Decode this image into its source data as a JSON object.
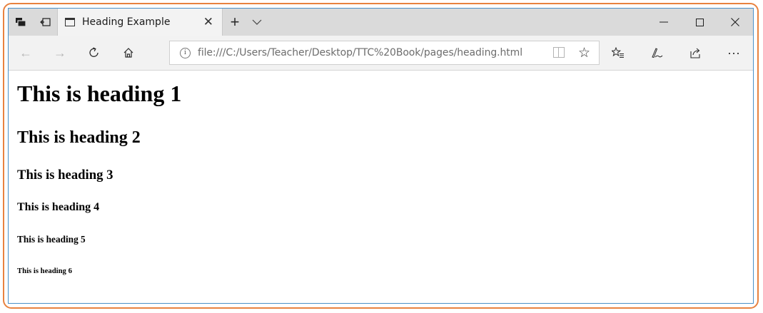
{
  "titlebar": {
    "tab_title": "Heading Example",
    "tab_close": "✕",
    "new_tab": "+",
    "tab_menu": "﹀",
    "minimize": "—",
    "maximize": "☐",
    "close": "✕",
    "icons": [
      "set-aside-tabs-icon",
      "tab-preview-icon",
      "page-icon"
    ]
  },
  "navbar": {
    "back": "←",
    "forward": "→",
    "refresh": "↻",
    "home": "⌂",
    "url": "file:///C:/Users/Teacher/Desktop/TTC%20Book/pages/heading.html",
    "info": "i",
    "favorite": "☆",
    "favorites_hub": "☆≡",
    "notes": "✎",
    "share": "⇪",
    "more": "···"
  },
  "page": {
    "h1": "This is heading 1",
    "h2": "This is heading 2",
    "h3": "This is heading 3",
    "h4": "This is heading 4",
    "h5": "This is heading 5",
    "h6": "This is heading 6"
  },
  "colors": {
    "frame_border": "#e8823f",
    "window_border": "#4a90c8",
    "titlebar_bg": "#dadada",
    "navbar_bg": "#f2f2f2"
  }
}
